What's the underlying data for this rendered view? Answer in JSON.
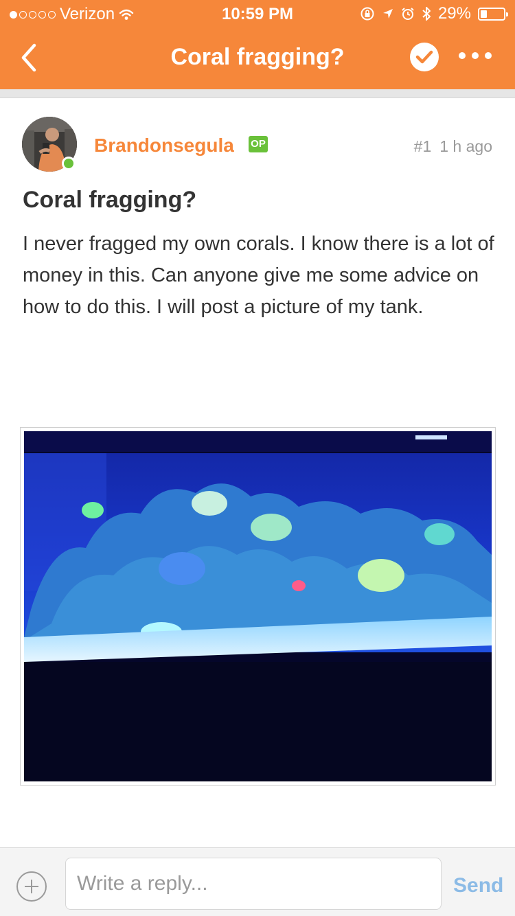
{
  "status_bar": {
    "carrier": "Verizon",
    "time": "10:59 PM",
    "battery": "29%",
    "battery_level": 0.29,
    "signal_bars_filled": 1,
    "signal_bars_total": 5
  },
  "nav": {
    "title": "Coral fragging?",
    "back_icon": "chevron-left-icon",
    "check_icon": "check-circle-icon",
    "more_icon": "more-horizontal-icon"
  },
  "post": {
    "author": "Brandonsegula",
    "op_badge": "OP",
    "number": "#1",
    "time_ago": "1 h ago",
    "title": "Coral fragging?",
    "body": "I never fragged my own corals. I know there is a lot of money in this. Can anyone give me some advice on how to do this. I will post a picture of my tank.",
    "online": true
  },
  "reply": {
    "placeholder": "Write a reply...",
    "send_label": "Send",
    "add_icon": "plus-circle-icon"
  },
  "colors": {
    "brand": "#f6873a",
    "op_badge": "#6ac13a",
    "send": "#8cbbe6",
    "meta": "#9a9a9a"
  }
}
